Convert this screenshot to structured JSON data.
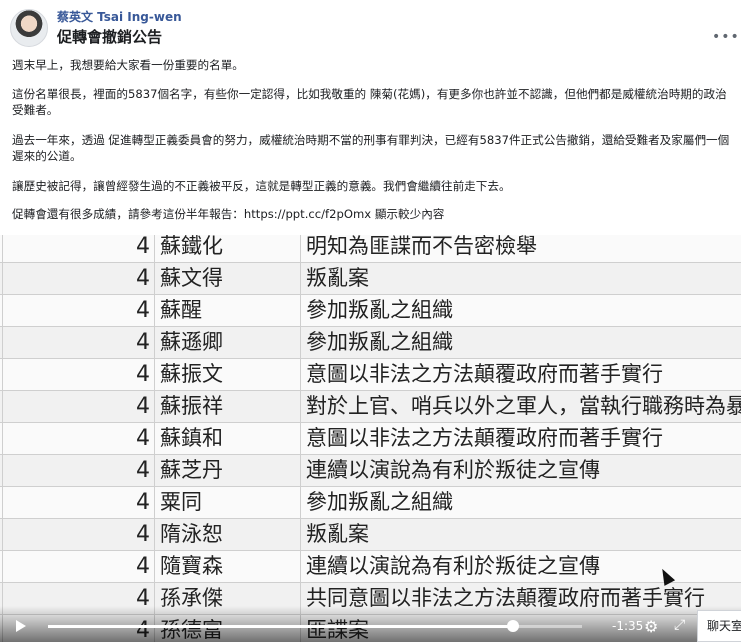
{
  "post": {
    "author": "蔡英文 Tsai Ing-wen",
    "title": "促轉會撤銷公告",
    "paragraphs": [
      "週末早上，我想要給大家看一份重要的名單。",
      "這份名單很長，裡面的5837個名字，有些你一定認得，比如我敬重的 陳菊(花媽)，有更多你也許並不認識，但他們都是威權統治時期的政治受難者。",
      "過去一年來，透過 促進轉型正義委員會的努力，威權統治時期不當的刑事有罪判決，已經有5837件正式公告撤銷，還給受難者及家屬們一個遲來的公道。",
      "讓歷史被記得，讓曾經發生過的不正義被平反，這就是轉型正義的意義。我們會繼續往前走下去。"
    ],
    "link_line_prefix": "促轉會還有很多成績，請參考這份半年報告：",
    "link_url": "https://ppt.cc/f2pOmx",
    "link_line_suffix": " 顯示較少內容",
    "more_icon": "more-horizontal-icon"
  },
  "sheet": {
    "rows": [
      {
        "num": "4",
        "name": "蘇鐵化",
        "reason": "明知為匪諜而不告密檢舉"
      },
      {
        "num": "4",
        "name": "蘇文得",
        "reason": "叛亂案"
      },
      {
        "num": "4",
        "name": "蘇醒",
        "reason": "參加叛亂之組織"
      },
      {
        "num": "4",
        "name": "蘇遜卿",
        "reason": "參加叛亂之組織"
      },
      {
        "num": "4",
        "name": "蘇振文",
        "reason": "意圖以非法之方法顛覆政府而著手實行"
      },
      {
        "num": "4",
        "name": "蘇振祥",
        "reason": "對於上官、哨兵以外之軍人，當執行職務時為暴"
      },
      {
        "num": "4",
        "name": "蘇鎮和",
        "reason": "意圖以非法之方法顛覆政府而著手實行"
      },
      {
        "num": "4",
        "name": "蘇芝丹",
        "reason": "連續以演說為有利於叛徒之宣傳"
      },
      {
        "num": "4",
        "name": "粟同",
        "reason": "參加叛亂之組織"
      },
      {
        "num": "4",
        "name": "隋泳恕",
        "reason": "叛亂案"
      },
      {
        "num": "4",
        "name": "隨寶森",
        "reason": "連續以演說為有利於叛徒之宣傳"
      },
      {
        "num": "4",
        "name": "孫承傑",
        "reason": "共同意圖以非法之方法顛覆政府而著手實行"
      },
      {
        "num": "4",
        "name": "孫德富",
        "reason": "匪諜案"
      }
    ]
  },
  "player": {
    "time_remaining": "-1:35",
    "progress_fraction": 0.87,
    "play_icon": "play-icon",
    "settings_icon": "gear-icon",
    "fullscreen_icon": "fullscreen-icon"
  },
  "chat_tab": {
    "label": "聊天室"
  }
}
